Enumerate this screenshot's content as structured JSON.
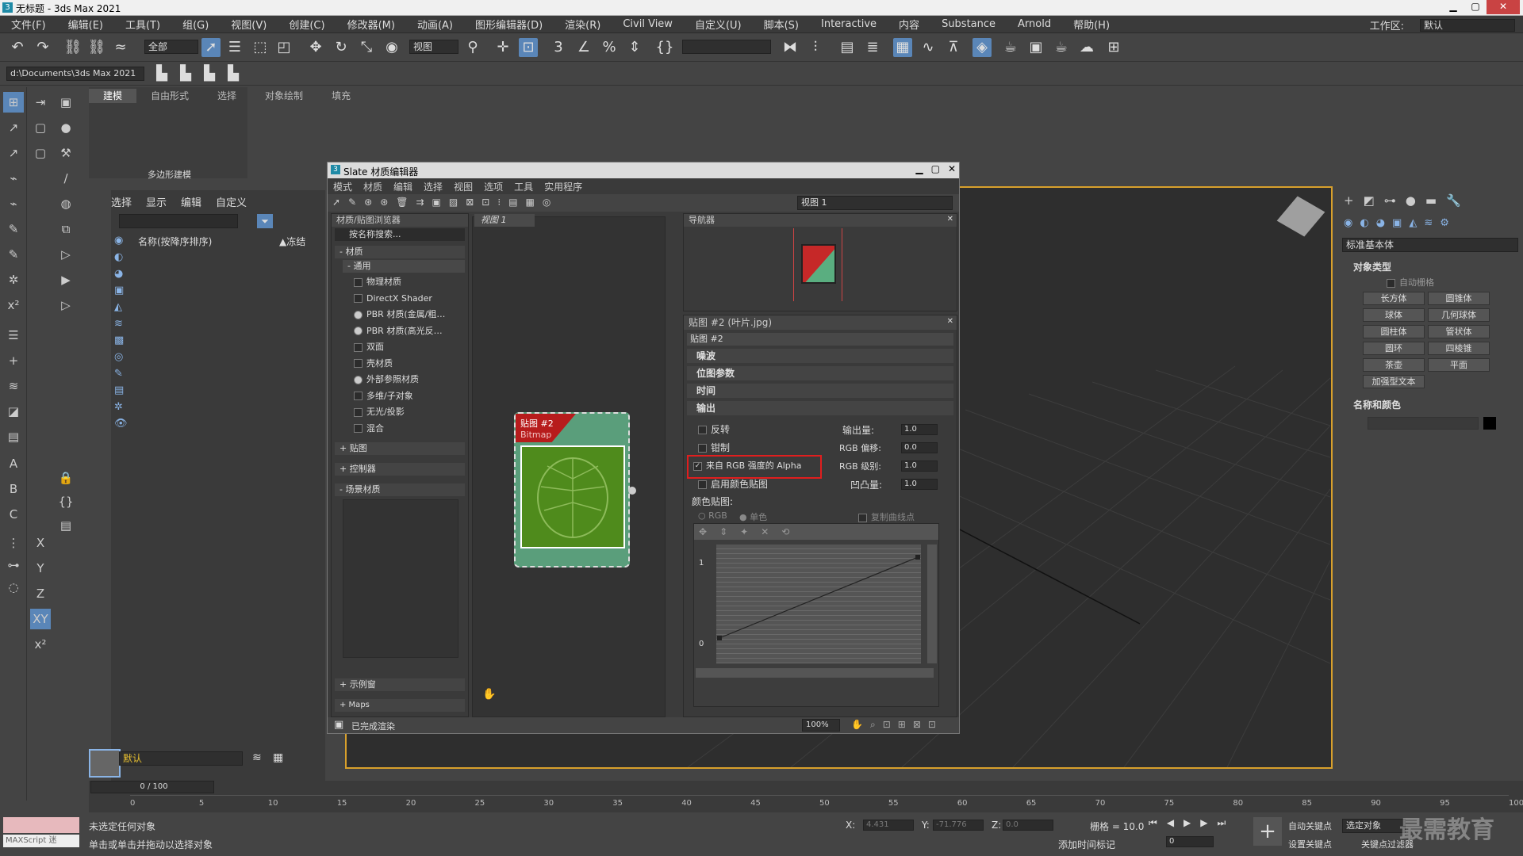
{
  "app": {
    "title": "无标题 - 3ds Max 2021"
  },
  "menu": [
    "文件(F)",
    "编辑(E)",
    "工具(T)",
    "组(G)",
    "视图(V)",
    "创建(C)",
    "修改器(M)",
    "动画(A)",
    "图形编辑器(D)",
    "渲染(R)",
    "Civil View",
    "自定义(U)",
    "脚本(S)",
    "Interactive",
    "内容",
    "Substance",
    "Arnold",
    "帮助(H)"
  ],
  "workspace": {
    "label": "工作区:",
    "value": "默认"
  },
  "toolbar": {
    "filter": "全部",
    "view": "视图"
  },
  "project_path": "d:\\Documents\\3ds Max 2021",
  "ribbon": {
    "tabs": [
      "建模",
      "自由形式",
      "选择",
      "对象绘制",
      "填充"
    ],
    "group": "多边形建模"
  },
  "scene_explorer": {
    "menu": [
      "选择",
      "显示",
      "编辑",
      "自定义"
    ],
    "col_name": "名称(按降序排序)",
    "col_frozen": "▲冻结"
  },
  "slate": {
    "title": "Slate 材质编辑器",
    "menu": [
      "模式",
      "材质",
      "编辑",
      "选择",
      "视图",
      "选项",
      "工具",
      "实用程序"
    ],
    "view_select": "视图 1",
    "browser": {
      "title": "材质/贴图浏览器",
      "search": "按名称搜索...",
      "materials": "- 材质",
      "general": "- 通用",
      "items": [
        "物理材质",
        "DirectX Shader",
        "PBR 材质(金属/粗…",
        "PBR 材质(高光反…",
        "双面",
        "壳材质",
        "外部参照材质",
        "多维/子对象",
        "无光/投影",
        "混合"
      ],
      "maps": "+ 贴图",
      "controllers": "+ 控制器",
      "scene": "- 场景材质",
      "samples": "+ 示例窗",
      "maps2": "+ Maps"
    },
    "view_tab": "视图 1",
    "node": {
      "title": "贴图 #2",
      "subtitle": "Bitmap"
    },
    "navigator": "导航器",
    "params": {
      "title": "贴图 #2 (叶片.jpg)",
      "name": "贴图 #2",
      "sections": [
        "噪波",
        "位图参数",
        "时间",
        "输出"
      ],
      "invert": "反转",
      "clamp": "钳制",
      "alpha": "来自 RGB 强度的 Alpha",
      "enable": "启用颜色贴图",
      "out_amount_l": "输出量:",
      "out_amount": "1.0",
      "rgb_offset_l": "RGB 偏移:",
      "rgb_offset": "0.0",
      "rgb_level_l": "RGB 级别:",
      "rgb_level": "1.0",
      "bump_l": "凹凸量:",
      "bump": "1.0",
      "colormap": "颜色贴图:",
      "rgb": "RGB",
      "mono": "单色",
      "copy": "复制曲线点",
      "y1": "1",
      "y0": "0"
    },
    "status": "已完成渲染",
    "zoom": "100%"
  },
  "command_panel": {
    "dropdown": "标准基本体",
    "obj_type": "对象类型",
    "autogrid": "自动栅格",
    "buttons": [
      "长方体",
      "圆锥体",
      "球体",
      "几何球体",
      "圆柱体",
      "管状体",
      "圆环",
      "四棱锥",
      "茶壶",
      "平面",
      "加强型文本"
    ],
    "name_color": "名称和颜色"
  },
  "timeline": {
    "frame": "0 / 100",
    "ticks": [
      "0",
      "5",
      "10",
      "15",
      "20",
      "25",
      "30",
      "35",
      "40",
      "45",
      "50",
      "55",
      "60",
      "65",
      "70",
      "75",
      "80",
      "85",
      "90",
      "95",
      "100"
    ]
  },
  "layer": "默认",
  "status": {
    "line1": "未选定任何对象",
    "line2": "单击或单击并拖动以选择对象",
    "maxscript": "MAXScript 迷",
    "x_l": "X:",
    "x": "4.431",
    "y_l": "Y:",
    "y": "-71.776",
    "z_l": "Z:",
    "z": "0.0",
    "grid": "栅格 = 10.0",
    "addtime": "添加时间标记",
    "autokey": "自动关键点",
    "setkey": "设置关键点",
    "selected": "选定对象",
    "keyfilter": "关键点过滤器",
    "frame": "0"
  },
  "watermark": "最需教育"
}
